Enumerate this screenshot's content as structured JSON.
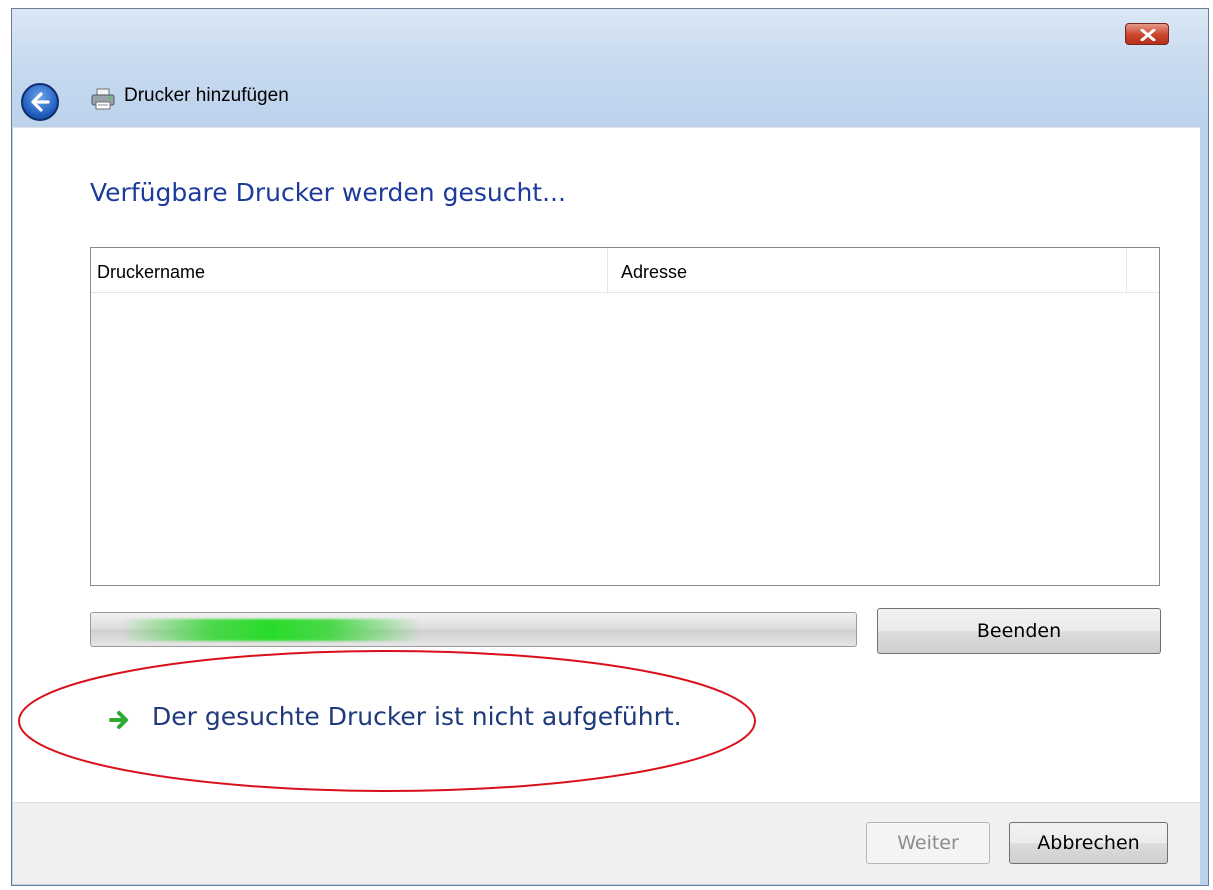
{
  "window": {
    "title": "Drucker hinzufügen"
  },
  "icons": {
    "close": "close-icon",
    "back": "back-arrow-icon",
    "printer": "printer-icon",
    "link_arrow": "green-arrow-icon"
  },
  "main": {
    "heading": "Verfügbare Drucker werden gesucht...",
    "table": {
      "columns": [
        "Druckername",
        "Adresse"
      ],
      "rows": []
    },
    "progress": {
      "state": "searching (indeterminate)"
    },
    "stop_button": "Beenden",
    "link": "Der gesuchte Drucker ist nicht aufgeführt."
  },
  "footer": {
    "next_button": "Weiter",
    "cancel_button": "Abbrechen"
  },
  "colors": {
    "heading": "#1e3a9a",
    "link": "#1e3a7a",
    "progress_glow": "#2fd22f",
    "annotation_ellipse": "#d9101a"
  }
}
